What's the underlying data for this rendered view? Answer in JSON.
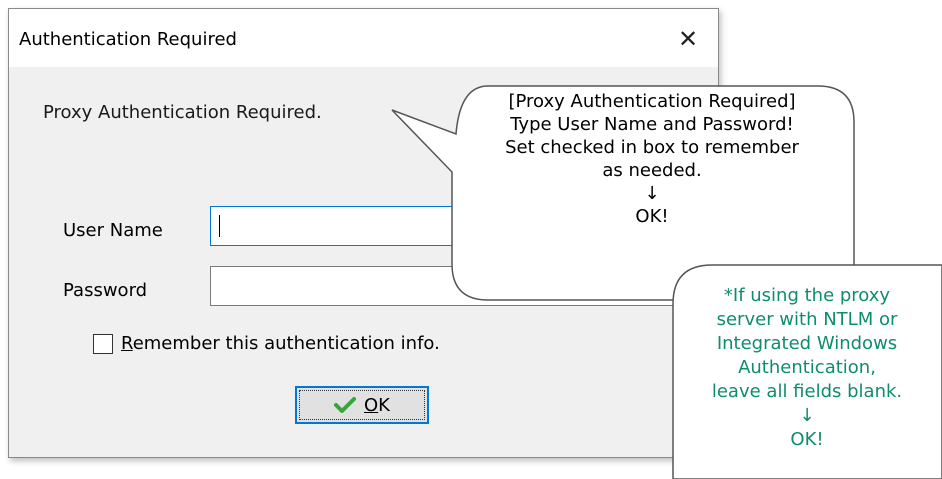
{
  "dialog": {
    "title": "Authentication Required",
    "message": "Proxy Authentication Required.",
    "user_name_label": "User Name",
    "user_name_value": "",
    "password_label": "Password",
    "password_value": "",
    "remember_label_first": "R",
    "remember_label_rest": "emember this authentication info.",
    "remember_checked": false,
    "ok_label_first": "O",
    "ok_label_rest": "K"
  },
  "callouts": {
    "main": [
      "[Proxy Authentication Required]",
      "Type User Name and Password!",
      "Set checked in box to remember",
      "as needed.",
      "↓",
      "OK!"
    ],
    "note": [
      "*If using the proxy",
      "server with NTLM or",
      "Integrated Windows",
      "Authentication,",
      "leave all fields blank.",
      "↓",
      "OK!"
    ]
  },
  "colors": {
    "accent": "#0078d7",
    "note_text": "#0e8d6e",
    "check_green": "#3aa63a"
  }
}
